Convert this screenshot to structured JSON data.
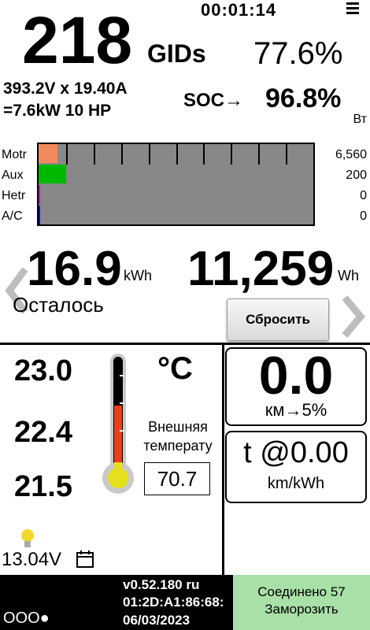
{
  "header": {
    "timer": "00:01:14",
    "gids_value": "218",
    "gids_unit": "GIDs",
    "percent": "77.6%",
    "power_line1": "393.2V x 19.40A",
    "power_line2": "=7.6kW  10 HP",
    "soc_label": "SOC→",
    "soc_value": "96.8%"
  },
  "energy": {
    "unit_label": "Вт",
    "rows": [
      {
        "label": "Motr",
        "value": "6,560",
        "color": "#f08a5d",
        "fraction": 0.07
      },
      {
        "label": "Aux",
        "value": "200",
        "color": "#00b800",
        "fraction": 0.1
      },
      {
        "label": "Hetr",
        "value": "0",
        "color": "#d000d0",
        "fraction": 0.005
      },
      {
        "label": "A/C",
        "value": "0",
        "color": "#0000ff",
        "fraction": 0.005
      }
    ]
  },
  "remaining": {
    "kwh_value": "16.9",
    "kwh_unit": "kWh",
    "wh_value": "11,259",
    "wh_unit": "Wh",
    "label": "Осталось",
    "reset_label": "Сбросить"
  },
  "temperatures": {
    "values": [
      "23.0",
      "22.4",
      "21.5"
    ],
    "unit": "°C",
    "outside_label": "Внешняя температу",
    "outside_value": "70.7",
    "battery_voltage": "13.04V"
  },
  "distance": {
    "value": "0.0",
    "unit": "км→5%"
  },
  "efficiency": {
    "value": "t @0.00",
    "unit": "km/kWh"
  },
  "footer": {
    "version": "v0.52.180 ru",
    "mac": "01:2D:A1:86:68:",
    "date": "06/03/2023",
    "dots": "OOO●",
    "connection_status": "Соединено 57",
    "freeze_label": "Заморозить"
  },
  "icons": {
    "menu": "menu-icon",
    "left_nav": "chevron-left-icon",
    "right_nav": "chevron-right-icon",
    "bulb": "bulb-icon",
    "calendar": "calendar-icon",
    "thermometer": "thermometer-icon"
  }
}
